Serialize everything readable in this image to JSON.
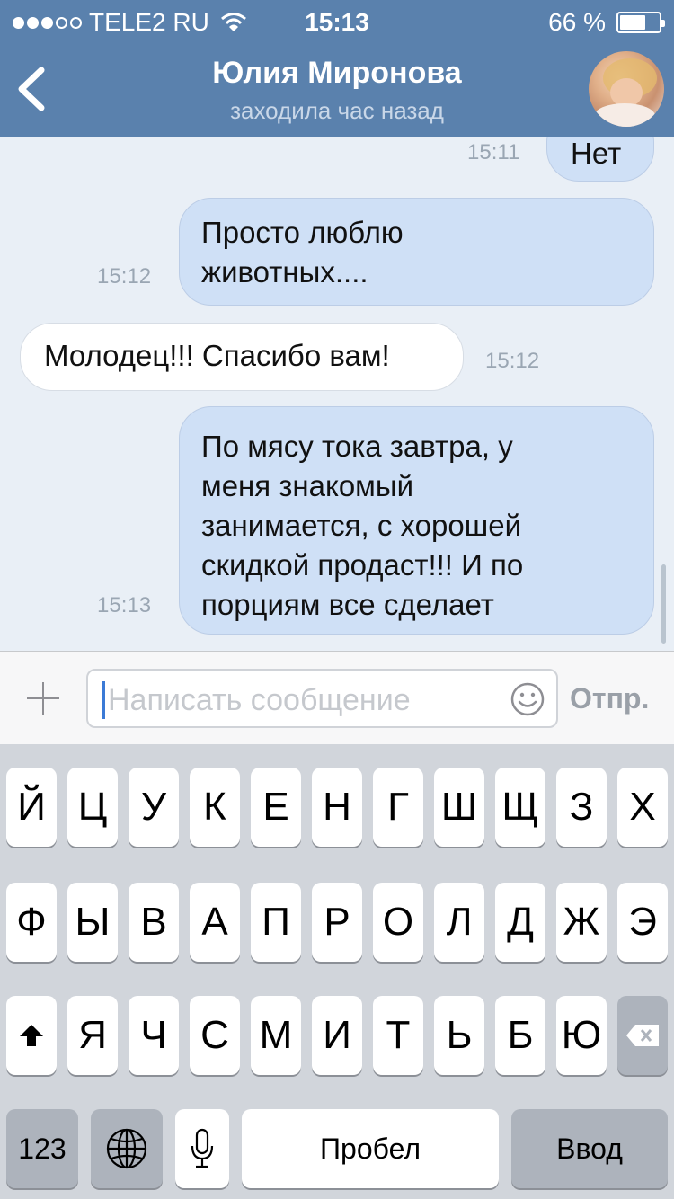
{
  "status_bar": {
    "carrier": "TELE2 RU",
    "time": "15:13",
    "battery_percent": "66 %",
    "battery_level": 0.66,
    "signal_bars_filled": 3,
    "signal_bars_total": 5
  },
  "nav": {
    "title": "Юлия Миронова",
    "subtitle": "заходила час назад"
  },
  "messages": [
    {
      "direction": "out",
      "text": "Нет",
      "time": "15:11"
    },
    {
      "direction": "out",
      "lines": [
        "Просто люблю",
        "животных...."
      ],
      "time": "15:12"
    },
    {
      "direction": "in",
      "text": "Молодец!!! Спасибо вам!",
      "time": "15:12"
    },
    {
      "direction": "out",
      "lines": [
        "По мясу тока завтра, у",
        "меня знакомый",
        "занимается, с хорошей",
        "скидкой продаст!!! И по",
        "порциям все сделает"
      ],
      "time": "15:13"
    }
  ],
  "input": {
    "placeholder": "Написать сообщение",
    "send_label": "Отпр."
  },
  "keyboard": {
    "row1": [
      "Й",
      "Ц",
      "У",
      "К",
      "Е",
      "Н",
      "Г",
      "Ш",
      "Щ",
      "З",
      "Х"
    ],
    "row2": [
      "Ф",
      "Ы",
      "В",
      "А",
      "П",
      "Р",
      "О",
      "Л",
      "Д",
      "Ж",
      "Э"
    ],
    "row3": [
      "Я",
      "Ч",
      "С",
      "М",
      "И",
      "Т",
      "Ь",
      "Б",
      "Ю"
    ],
    "numbers_label": "123",
    "space_label": "Пробел",
    "return_label": "Ввод"
  }
}
